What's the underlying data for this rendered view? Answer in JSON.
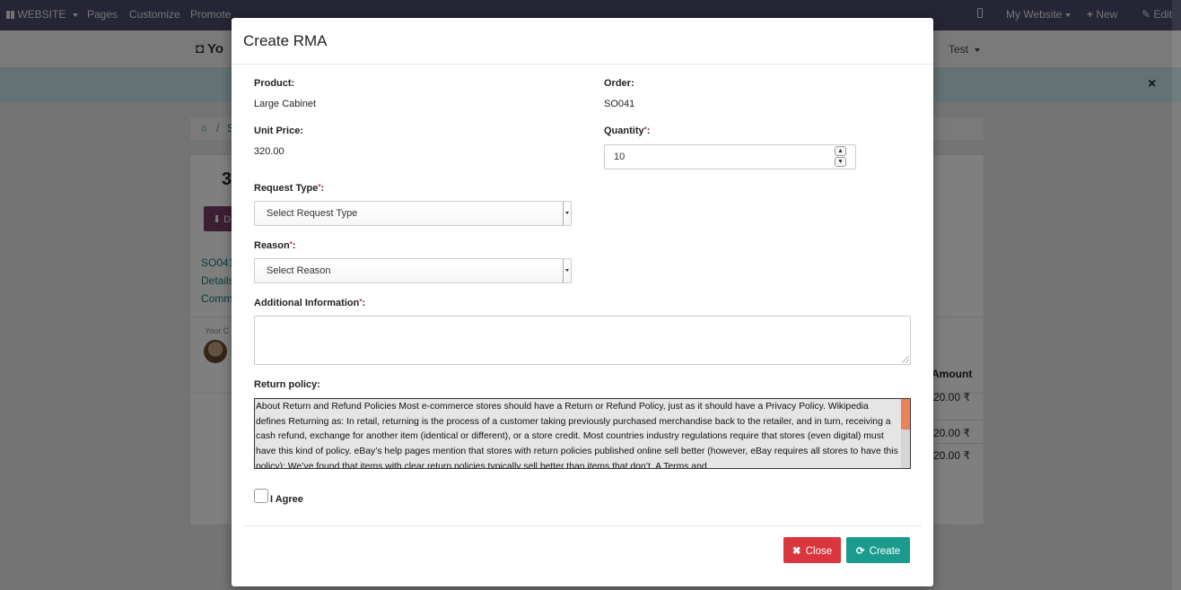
{
  "topbar": {
    "website": "WEBSITE",
    "pages": "Pages",
    "customize": "Customize",
    "promote": "Promote",
    "my_website": "My Website",
    "new": "New",
    "edit": "Edit"
  },
  "background": {
    "brand": "Yo",
    "menu_test": "Test",
    "breadcrumb_sep": "/",
    "breadcrumb_s": "S",
    "bignum": "3",
    "download_btn": "D",
    "links": [
      "SO041",
      "Details",
      "Commu"
    ],
    "your_label": "Your C",
    "amount_header": "Amount",
    "amounts": [
      "20.00 ₹",
      "20.00 ₹",
      "20.00 ₹"
    ]
  },
  "modal": {
    "title": "Create RMA",
    "product_label": "Product:",
    "product_value": "Large Cabinet",
    "order_label": "Order:",
    "order_value": "SO041",
    "unit_price_label": "Unit Price:",
    "unit_price_value": "320.00",
    "quantity_label": "Quantity",
    "quantity_value": "10",
    "request_type_label": "Request Type",
    "request_type_value": "Select Request Type",
    "reason_label": "Reason",
    "reason_value": "Select Reason",
    "additional_info_label": "Additional Information",
    "additional_info_value": "",
    "return_policy_label": "Return policy:",
    "return_policy_text": "About Return and Refund Policies Most e-commerce stores should have a Return or Refund Policy, just as it should have a Privacy Policy. Wikipedia defines Returning as: In retail, returning is the process of a customer taking previously purchased merchandise back to the retailer, and in turn, receiving a cash refund, exchange for another item (identical or different), or a store credit. Most countries industry regulations require that stores (even digital) must have this kind of policy. eBay’s help pages mention that stores with return policies published online sell better (however, eBay requires all stores to have this policy): We’ve found that items with clear return policies typically sell better than items that don’t. A Terms and",
    "agree_label": "I Agree",
    "close_label": "Close",
    "create_label": "Create",
    "required_mark": "*",
    "colon": ":"
  },
  "colors": {
    "topbar": "#4a4a6a",
    "close_button": "#d9363e",
    "create_button": "#1a9b8e",
    "scroll_thumb": "#e8835a",
    "required": "#d9262c"
  }
}
